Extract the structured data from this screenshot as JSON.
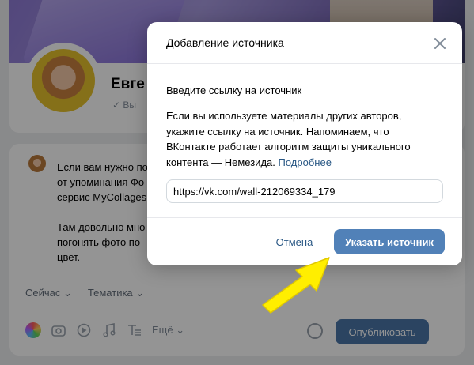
{
  "profile": {
    "name": "Евге",
    "status": "Вы"
  },
  "post": {
    "text": "Если вам нужно по\nот упоминания Фо\nсервис MyCollages\n\nТам довольно мно\nпогонять фото по\nцвет.",
    "meta": [
      "Сейчас",
      "Тематика"
    ],
    "more_label": "Ещё",
    "publish_label": "Опубликовать"
  },
  "modal": {
    "title": "Добавление источника",
    "field_label": "Введите ссылку на источник",
    "description": "Если вы используете материалы других авторов, укажите ссылку на источник. Напоминаем, что ВКонтакте работает алгоритм защиты уникального контента — Немезида.",
    "more_link": "Подробнее",
    "url_value": "https://vk.com/wall-212069334_179",
    "cancel_label": "Отмена",
    "confirm_label": "Указать источник"
  },
  "colors": {
    "accent": "#5181b8",
    "link": "#2a5885",
    "arrow": "#ffee00"
  },
  "icons": [
    "close-icon",
    "camera-icon",
    "video-icon",
    "music-icon",
    "text-format-icon",
    "settings-icon",
    "color-palette-icon",
    "chevron-down-icon",
    "arrow-pointer"
  ]
}
